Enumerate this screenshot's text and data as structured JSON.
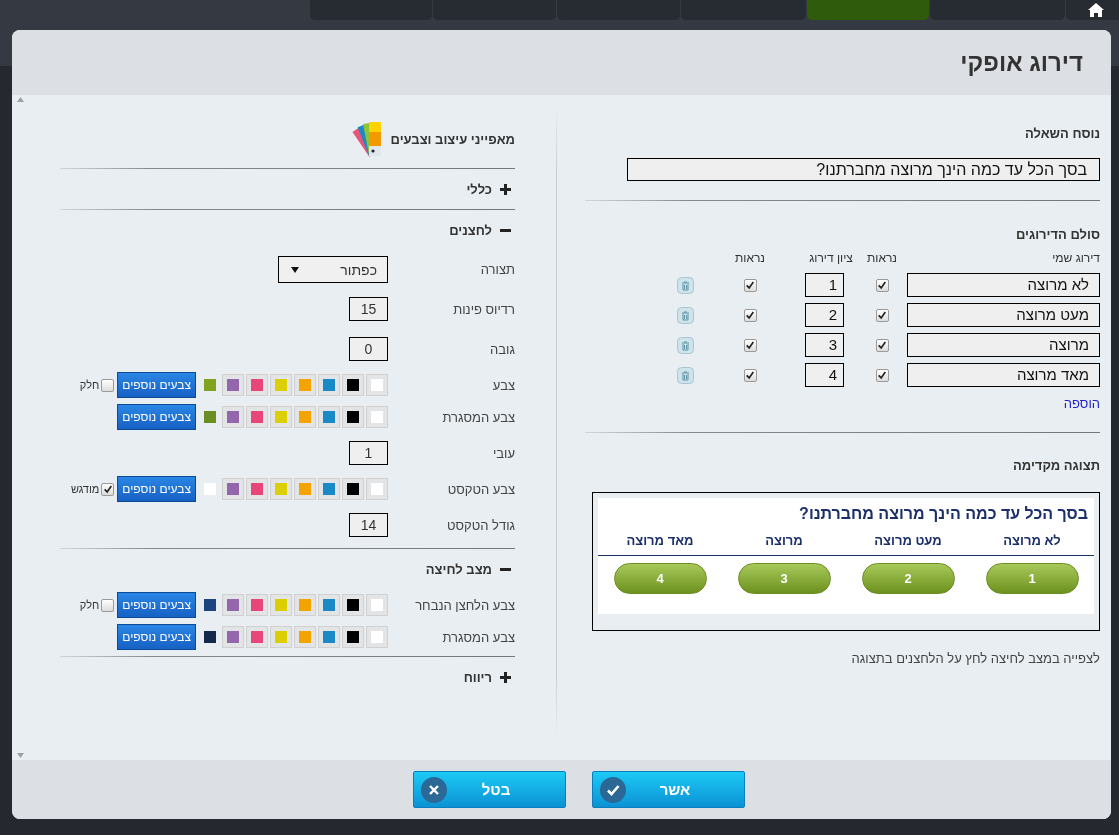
{
  "background_tabs": [
    {
      "kind": "text",
      "selected": false
    },
    {
      "kind": "text",
      "selected": false
    },
    {
      "kind": "text",
      "selected": false
    },
    {
      "kind": "text",
      "selected": false
    },
    {
      "kind": "text",
      "selected": true
    },
    {
      "kind": "text",
      "selected": false
    },
    {
      "kind": "home",
      "selected": false
    }
  ],
  "dialog": {
    "title": "דירוג אופקי"
  },
  "question": {
    "label": "נוסח השאלה",
    "value": "בסך הכל עד כמה הינך מרוצה מחברתנו?"
  },
  "scale": {
    "title": "סולם הדירוגים",
    "columns": [
      "דירוג שמי",
      "נראות",
      "ציון דירוג",
      "נראות"
    ],
    "rows": [
      {
        "name": "לא מרוצה",
        "name_visible": true,
        "score": "1",
        "score_visible": true
      },
      {
        "name": "מעט מרוצה",
        "name_visible": true,
        "score": "2",
        "score_visible": true
      },
      {
        "name": "מרוצה",
        "name_visible": true,
        "score": "3",
        "score_visible": true
      },
      {
        "name": "מאד מרוצה",
        "name_visible": true,
        "score": "4",
        "score_visible": true
      }
    ],
    "add_link": "הוספה"
  },
  "preview": {
    "title": "תצוגה מקדימה",
    "question": "בסך הכל עד כמה הינך מרוצה מחברתנו?",
    "options": [
      {
        "label": "לא מרוצה",
        "button": "1"
      },
      {
        "label": "מעט מרוצה",
        "button": "2"
      },
      {
        "label": "מרוצה",
        "button": "3"
      },
      {
        "label": "מאד מרוצה",
        "button": "4"
      }
    ],
    "hint": "לצפייה במצב לחיצה לחץ על הלחצנים בתצוגה"
  },
  "design": {
    "title": "מאפייני עיצוב וצבעים",
    "sections": [
      {
        "title": "כללי",
        "expanded": false
      },
      {
        "title": "לחצנים",
        "expanded": true,
        "fields": [
          {
            "kind": "select",
            "label": "תצורה",
            "value": "כפתור"
          },
          {
            "kind": "number",
            "label": "רדיוס פינות",
            "value": "15"
          },
          {
            "kind": "number",
            "label": "גובה",
            "value": "0"
          },
          {
            "kind": "colors",
            "label": "צבע",
            "swatches": [
              {
                "color": "#ffffff"
              },
              {
                "color": "#000000"
              },
              {
                "color": "#1a8ac6"
              },
              {
                "color": "#f5a300"
              },
              {
                "color": "#dccf00"
              },
              {
                "color": "#e8457a"
              },
              {
                "color": "#9467ad"
              }
            ],
            "current": {
              "color": "#7fa31f"
            },
            "more": "צבעים נוספים",
            "option": {
              "label": "חלק",
              "checked": false
            }
          },
          {
            "kind": "colors",
            "label": "צבע המסגרת",
            "swatches": [
              {
                "color": "#ffffff"
              },
              {
                "color": "#000000"
              },
              {
                "color": "#1a8ac6"
              },
              {
                "color": "#f5a300"
              },
              {
                "color": "#dccf00"
              },
              {
                "color": "#e8457a"
              },
              {
                "color": "#9467ad"
              }
            ],
            "current": {
              "color": "#6b8e23"
            },
            "more": "צבעים נוספים"
          },
          {
            "kind": "number",
            "label": "עובי",
            "value": "1"
          },
          {
            "kind": "colors",
            "label": "צבע הטקסט",
            "swatches": [
              {
                "color": "#ffffff"
              },
              {
                "color": "#000000"
              },
              {
                "color": "#1a8ac6"
              },
              {
                "color": "#f5a300"
              },
              {
                "color": "#dccf00"
              },
              {
                "color": "#e8457a"
              },
              {
                "color": "#9467ad"
              }
            ],
            "current": {
              "color": "#ffffff"
            },
            "more": "צבעים נוספים",
            "option": {
              "label": "מודגש",
              "checked": true
            }
          },
          {
            "kind": "number",
            "label": "גודל הטקסט",
            "value": "14"
          }
        ]
      },
      {
        "title": "מצב לחיצה",
        "expanded": true,
        "fields": [
          {
            "kind": "colors",
            "label": "צבע הלחצן הנבחר",
            "swatches": [
              {
                "color": "#ffffff"
              },
              {
                "color": "#000000"
              },
              {
                "color": "#1a8ac6"
              },
              {
                "color": "#f5a300"
              },
              {
                "color": "#dccf00"
              },
              {
                "color": "#e8457a"
              },
              {
                "color": "#9467ad"
              }
            ],
            "current": {
              "color": "#1c4580"
            },
            "more": "צבעים נוספים",
            "option": {
              "label": "חלק",
              "checked": false
            }
          },
          {
            "kind": "colors",
            "label": "צבע המסגרת",
            "swatches": [
              {
                "color": "#ffffff"
              },
              {
                "color": "#000000"
              },
              {
                "color": "#1a8ac6"
              },
              {
                "color": "#f5a300"
              },
              {
                "color": "#dccf00"
              },
              {
                "color": "#e8457a"
              },
              {
                "color": "#9467ad"
              }
            ],
            "current": {
              "color": "#14284a"
            },
            "more": "צבעים נוספים"
          }
        ]
      },
      {
        "title": "ריווח",
        "expanded": false
      }
    ]
  },
  "buttons": [
    {
      "kind": "confirm",
      "label": "אשר"
    },
    {
      "kind": "cancel",
      "label": "בטל"
    }
  ]
}
